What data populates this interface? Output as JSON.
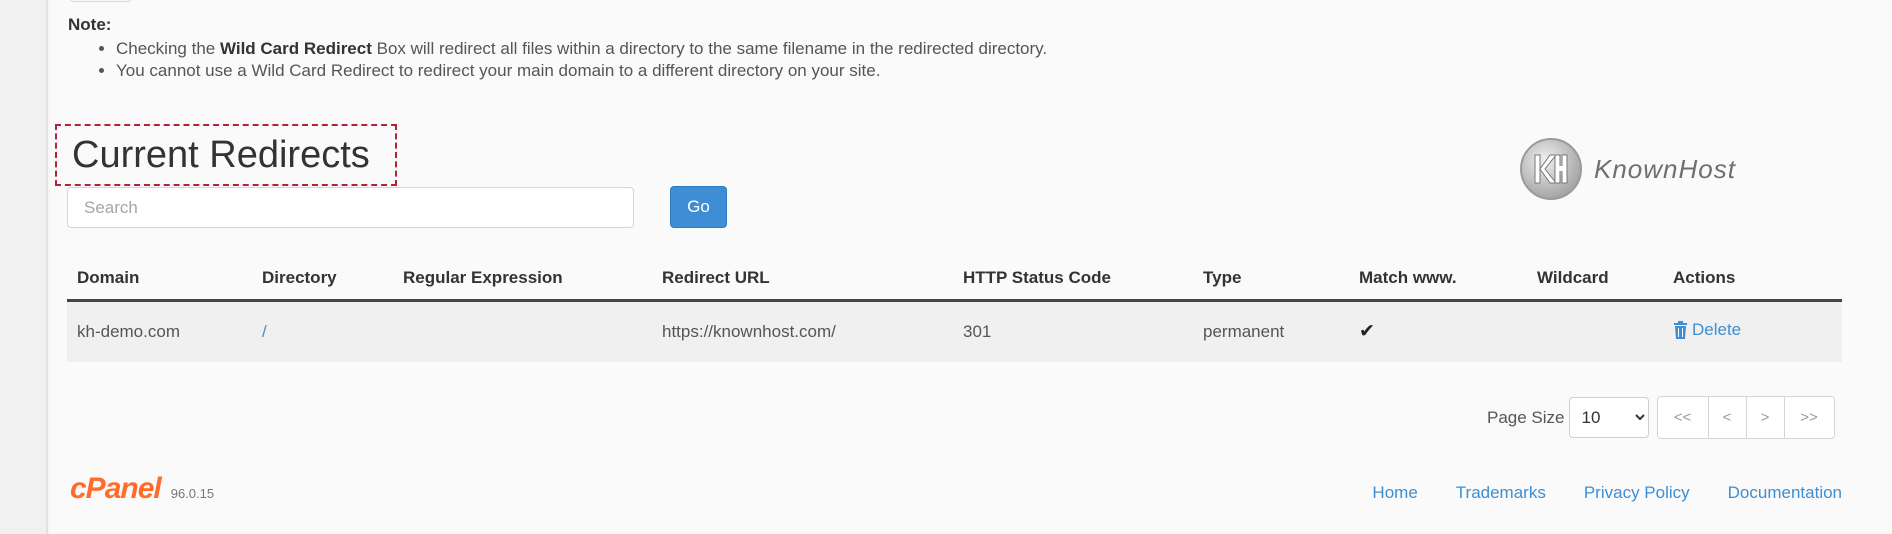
{
  "notes": {
    "title": "Note:",
    "item1_prefix": "Checking the ",
    "item1_bold": "Wild Card Redirect",
    "item1_suffix": " Box will redirect all files within a directory to the same filename in the redirected directory.",
    "item2": "You cannot use a Wild Card Redirect to redirect your main domain to a different directory on your site."
  },
  "page_title": "Current Redirects",
  "brand": {
    "logo_text": "KnownHost",
    "icon": "knownhost-kh-logo-icon"
  },
  "search": {
    "placeholder": "Search",
    "value": "",
    "go_label": "Go"
  },
  "table": {
    "headers": [
      "Domain",
      "Directory",
      "Regular Expression",
      "Redirect URL",
      "HTTP Status Code",
      "Type",
      "Match www.",
      "Wildcard",
      "Actions"
    ],
    "rows": [
      {
        "domain": "kh-demo.com",
        "directory": "/",
        "regex": "",
        "redirect_url": "https://knownhost.com/",
        "status_code": "301",
        "type": "permanent",
        "match_www_icon": "check-icon",
        "wildcard": "",
        "action_label": "Delete",
        "action_icon": "trash-icon"
      }
    ]
  },
  "pagination": {
    "page_size_label": "Page Size",
    "page_size": "10",
    "first": "<<",
    "prev": "<",
    "next": ">",
    "last": ">>"
  },
  "footer": {
    "cpanel_logo": "cPanel",
    "version": "96.0.15",
    "links": [
      "Home",
      "Trademarks",
      "Privacy Policy",
      "Documentation"
    ]
  },
  "colors": {
    "link": "#3d8ed4",
    "button": "#3d8ed4",
    "highlight_border": "#b3223a",
    "cpanel_orange": "#ff6c2c"
  }
}
